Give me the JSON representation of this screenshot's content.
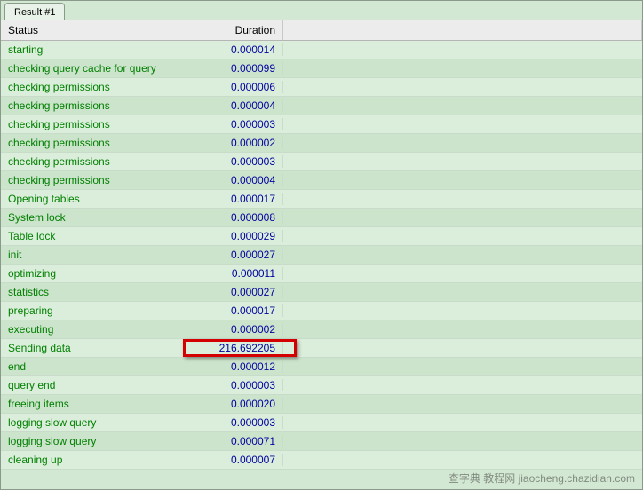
{
  "tab": {
    "label": "Result #1"
  },
  "columns": {
    "status": "Status",
    "duration": "Duration"
  },
  "rows": [
    {
      "status": "starting",
      "duration": "0.000014"
    },
    {
      "status": "checking query cache for query",
      "duration": "0.000099"
    },
    {
      "status": "checking permissions",
      "duration": "0.000006"
    },
    {
      "status": "checking permissions",
      "duration": "0.000004"
    },
    {
      "status": "checking permissions",
      "duration": "0.000003"
    },
    {
      "status": "checking permissions",
      "duration": "0.000002"
    },
    {
      "status": "checking permissions",
      "duration": "0.000003"
    },
    {
      "status": "checking permissions",
      "duration": "0.000004"
    },
    {
      "status": "Opening tables",
      "duration": "0.000017"
    },
    {
      "status": "System lock",
      "duration": "0.000008"
    },
    {
      "status": "Table lock",
      "duration": "0.000029"
    },
    {
      "status": "init",
      "duration": "0.000027"
    },
    {
      "status": "optimizing",
      "duration": "0.000011"
    },
    {
      "status": "statistics",
      "duration": "0.000027"
    },
    {
      "status": "preparing",
      "duration": "0.000017"
    },
    {
      "status": "executing",
      "duration": "0.000002"
    },
    {
      "status": "Sending data",
      "duration": "216.692205"
    },
    {
      "status": "end",
      "duration": "0.000012"
    },
    {
      "status": "query end",
      "duration": "0.000003"
    },
    {
      "status": "freeing items",
      "duration": "0.000020"
    },
    {
      "status": "logging slow query",
      "duration": "0.000003"
    },
    {
      "status": "logging slow query",
      "duration": "0.000071"
    },
    {
      "status": "cleaning up",
      "duration": "0.000007"
    }
  ],
  "highlight_row_index": 16,
  "watermark": "查字典 教程网\njiaocheng.chazidian.com"
}
